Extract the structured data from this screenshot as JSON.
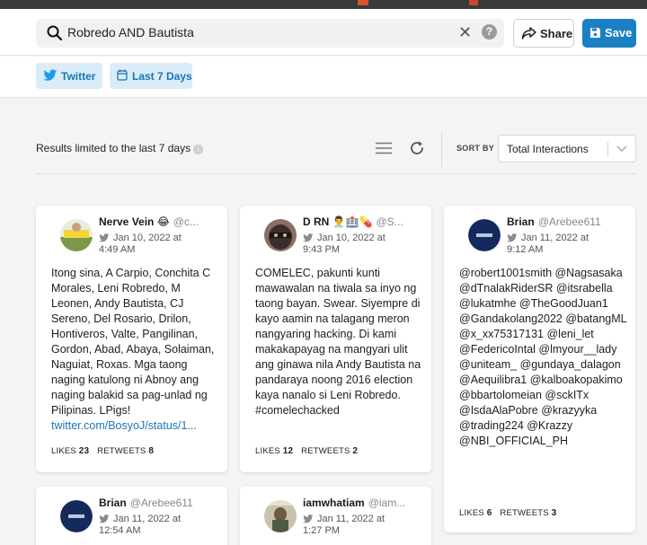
{
  "search": {
    "query": "Robredo AND Bautista"
  },
  "header": {
    "share_label": "Share",
    "save_label": "Save",
    "icons": [
      "search-icon",
      "clear-icon",
      "help-icon",
      "share-icon",
      "save-icon"
    ]
  },
  "filters": {
    "network_label": "Twitter",
    "range_label": "Last 7 Days"
  },
  "results": {
    "note": "Results limited to the last 7 days",
    "sort_by_label": "SORT BY",
    "sort_value": "Total Interactions"
  },
  "colors": {
    "accent": "#1a80c4",
    "chip_bg": "#d9ecf8",
    "link": "#1a75b8"
  },
  "posts": [
    {
      "name": "Nerve Vein 😂",
      "handle": "@c...",
      "date": "Jan 10, 2022 at",
      "time": "4:49 AM",
      "text": "Itong sina, A Carpio, Conchita C Morales, Leni Robredo, M Leonen, Andy Bautista, CJ Sereno, Del Rosario, Drilon, Hontiveros, Valte, Pangilinan, Gordon, Abad, Abaya, Solaiman, Naguiat, Roxas. Mga taong naging katulong ni Abnoy ang naging balakid sa pag-unlad ng Pilipinas. LPigs! ",
      "link": "twitter.com/BosyoJ/status/1...",
      "likes_label": "LIKES",
      "likes": "23",
      "retweets_label": "RETWEETS",
      "retweets": "8"
    },
    {
      "name": "D RN 👨‍⚕️🏥💊",
      "handle": "@S...",
      "date": "Jan 10, 2022 at",
      "time": "9:43 PM",
      "text": "COMELEC, pakunti kunti mawawalan na tiwala sa inyo ng taong bayan. Swear. Siyempre di kayo aamin na talagang meron nangyaring hacking. Di kami makakapayag na mangyari ulit ang ginawa nila Andy Bautista na pandaraya noong 2016 election kaya nanalo si Leni Robredo. #comelechacked",
      "likes_label": "LIKES",
      "likes": "12",
      "retweets_label": "RETWEETS",
      "retweets": "2"
    },
    {
      "name": "Brian",
      "handle": "@Arebee611",
      "date": "Jan 11, 2022 at",
      "time": "9:12 AM",
      "text": "@robert1001smith @Nagsasaka @dTnalakRiderSR @itsrabella @lukatmhe @TheGoodJuan1 @Gandakolang2022 @batangML @x_xx75317131 @leni_let @FedericoIntal @lmyour__lady @uniteam_ @gundaya_dalagon @Aequilibra1 @kalboakopakimo @bbartolomeian @sckITx @IsdaAlaPobre @krazyyka @trading224 @Krazzy @NBI_OFFICIAL_PH",
      "likes_label": "LIKES",
      "likes": "6",
      "retweets_label": "RETWEETS",
      "retweets": "3"
    },
    {
      "name": "Brian",
      "handle": "@Arebee611",
      "date": "Jan 11, 2022 at",
      "time": "12:54 AM"
    },
    {
      "name": "iamwhatiam",
      "handle": "@iam...",
      "date": "Jan 11, 2022 at",
      "time": "1:27 PM"
    }
  ]
}
